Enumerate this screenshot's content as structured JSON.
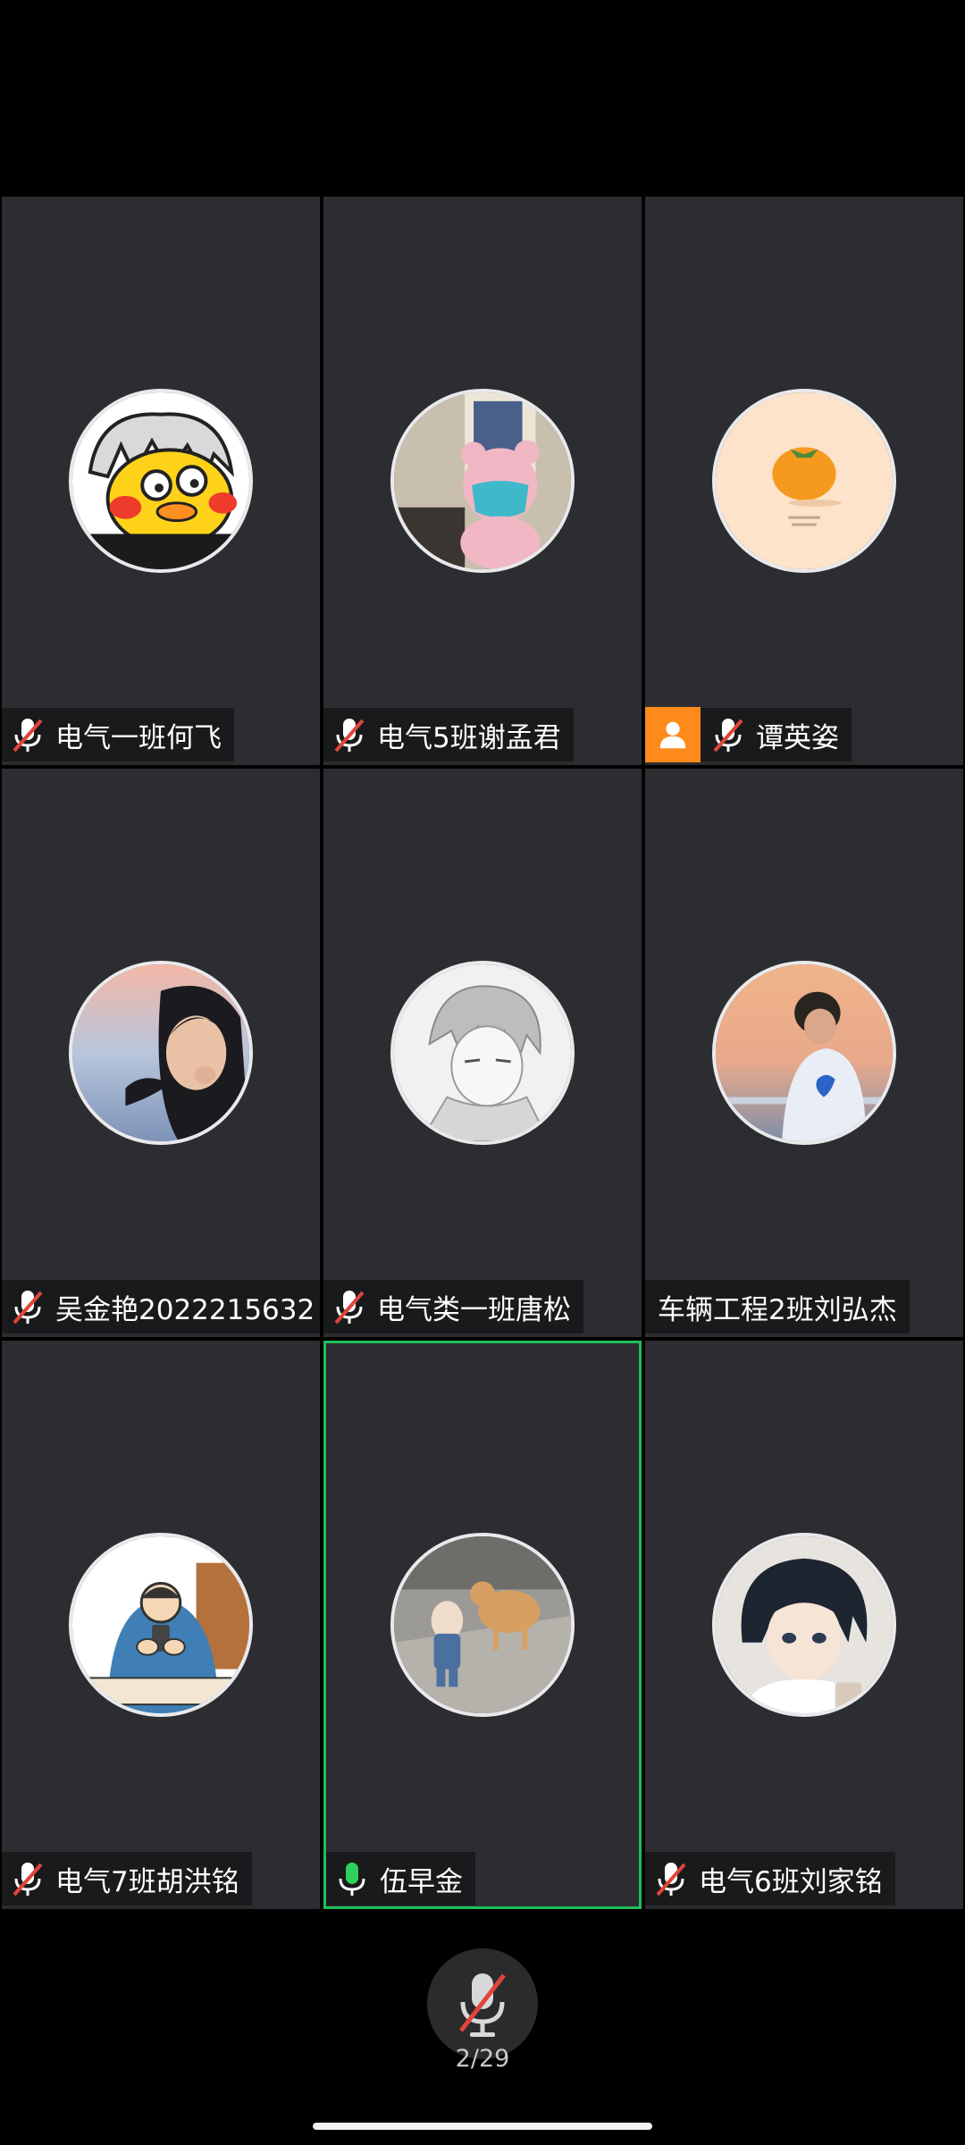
{
  "participants": [
    {
      "name": "电气一班何飞",
      "mic": "muted",
      "avatar": "cartoon-duck"
    },
    {
      "name": "电气5班谢孟君",
      "mic": "muted",
      "avatar": "pink-bear-mask"
    },
    {
      "name": "谭英姿",
      "mic": "muted",
      "avatar": "orange-fruit",
      "badge": "person-icon"
    },
    {
      "name": "吴金艳2022215632",
      "mic": "muted",
      "avatar": "girl-seaside"
    },
    {
      "name": "电气类一班唐松",
      "mic": "muted",
      "avatar": "anime-boy-sketch"
    },
    {
      "name": "车辆工程2班刘弘杰",
      "mic": "none",
      "avatar": "boy-sunset"
    },
    {
      "name": "电气7班胡洪铭",
      "mic": "muted",
      "avatar": "cartoon-phone-person"
    },
    {
      "name": "伍早金",
      "mic": "active",
      "avatar": "child-and-dog",
      "speaking": true
    },
    {
      "name": "电气6班刘家铭",
      "mic": "muted",
      "avatar": "anime-boy-dark-hair"
    }
  ],
  "footer": {
    "mic_button_icon": "mic-muted-icon",
    "page_indicator": "2/29"
  },
  "colors": {
    "tile_bg": "#2c2d30",
    "speaking_border": "#1fbf5a",
    "muted_slash": "#e0453a",
    "active_mic": "#2fd05a",
    "badge_orange": "#ff8a1c"
  }
}
